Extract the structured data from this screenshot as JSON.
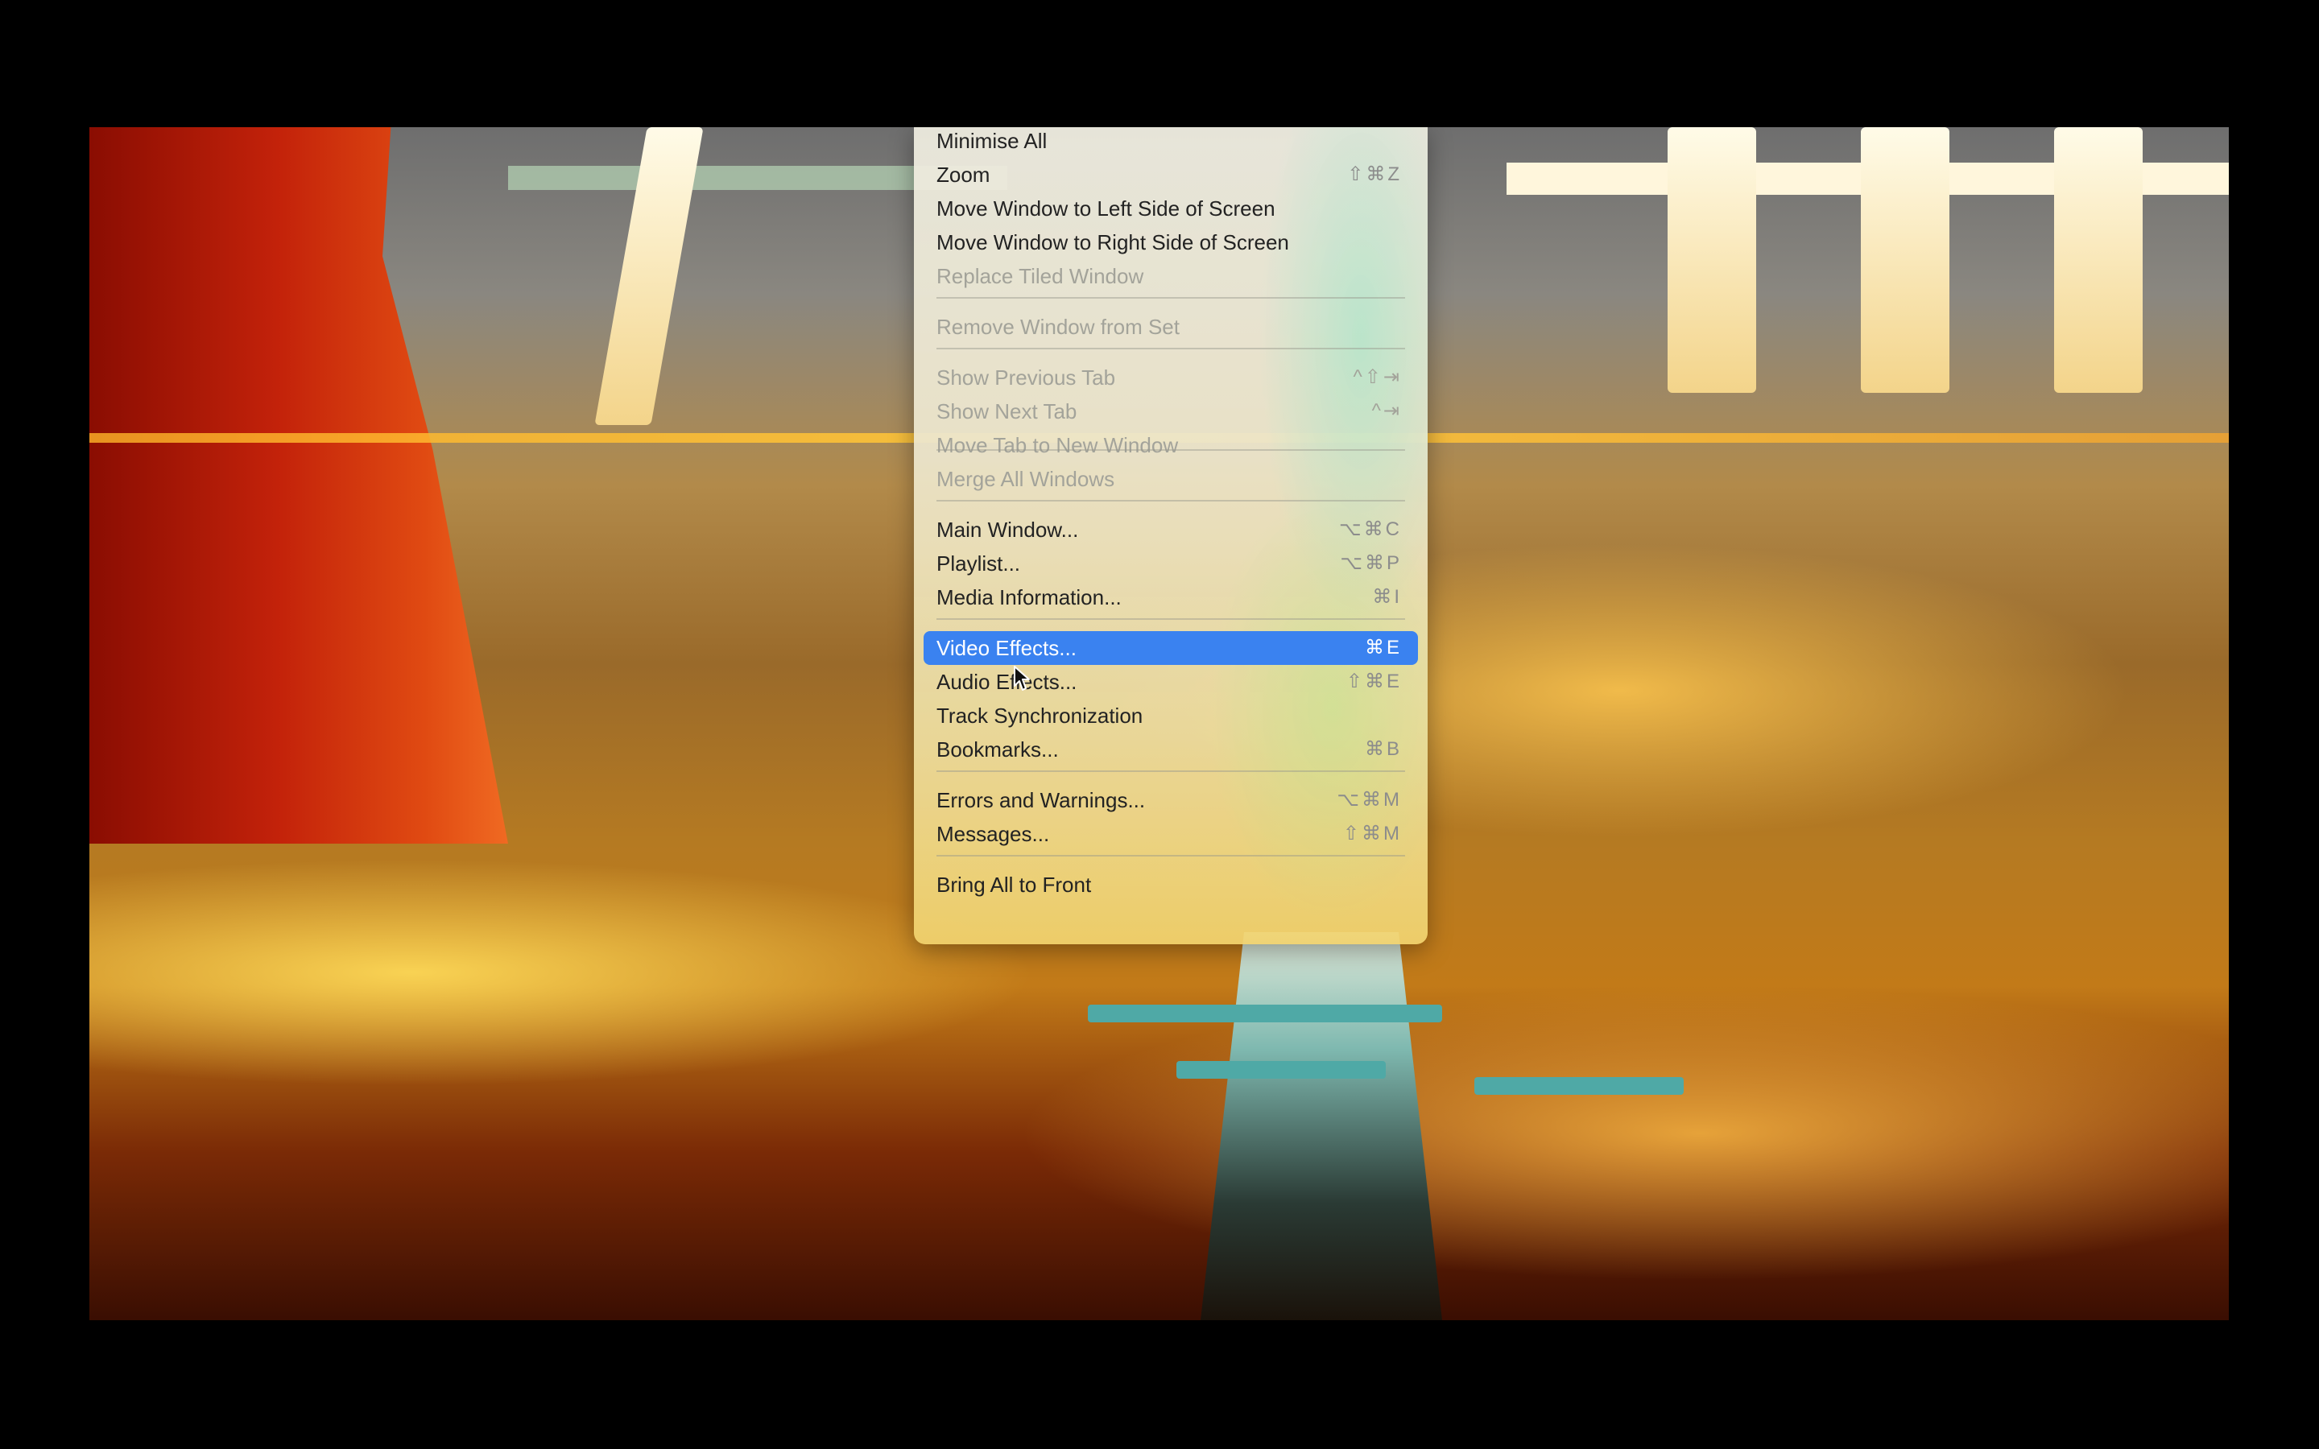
{
  "menu": {
    "items": [
      {
        "label": "Minimise All",
        "shortcut": "",
        "disabled": false
      },
      {
        "label": "Zoom",
        "shortcut": "⇧⌘Z",
        "disabled": false
      },
      {
        "label": "Move Window to Left Side of Screen",
        "shortcut": "",
        "disabled": false
      },
      {
        "label": "Move Window to Right Side of Screen",
        "shortcut": "",
        "disabled": false
      },
      {
        "label": "Replace Tiled Window",
        "shortcut": "",
        "disabled": true
      },
      {
        "label": "Remove Window from Set",
        "shortcut": "",
        "disabled": true
      },
      {
        "label": "Show Previous Tab",
        "shortcut": "^⇧⇥",
        "disabled": true
      },
      {
        "label": "Show Next Tab",
        "shortcut": "^⇥",
        "disabled": true
      },
      {
        "label": "Move Tab to New Window",
        "shortcut": "",
        "disabled": true
      },
      {
        "label": "Merge All Windows",
        "shortcut": "",
        "disabled": true
      },
      {
        "label": "Main Window...",
        "shortcut": "⌥⌘C",
        "disabled": false
      },
      {
        "label": "Playlist...",
        "shortcut": "⌥⌘P",
        "disabled": false
      },
      {
        "label": "Media Information...",
        "shortcut": "⌘I",
        "disabled": false
      },
      {
        "label": "Video Effects...",
        "shortcut": "⌘E",
        "disabled": false,
        "highlighted": true
      },
      {
        "label": "Audio Effects...",
        "shortcut": "⇧⌘E",
        "disabled": false
      },
      {
        "label": "Track Synchronization",
        "shortcut": "",
        "disabled": false
      },
      {
        "label": "Bookmarks...",
        "shortcut": "⌘B",
        "disabled": false
      },
      {
        "label": "Errors and Warnings...",
        "shortcut": "⌥⌘M",
        "disabled": false
      },
      {
        "label": "Messages...",
        "shortcut": "⇧⌘M",
        "disabled": false
      },
      {
        "label": "Bring All to Front",
        "shortcut": "",
        "disabled": false
      }
    ]
  },
  "colors": {
    "highlight": "#3a82f0",
    "background": "#000000"
  },
  "icons": {
    "cursor": "arrow-cursor-icon"
  }
}
